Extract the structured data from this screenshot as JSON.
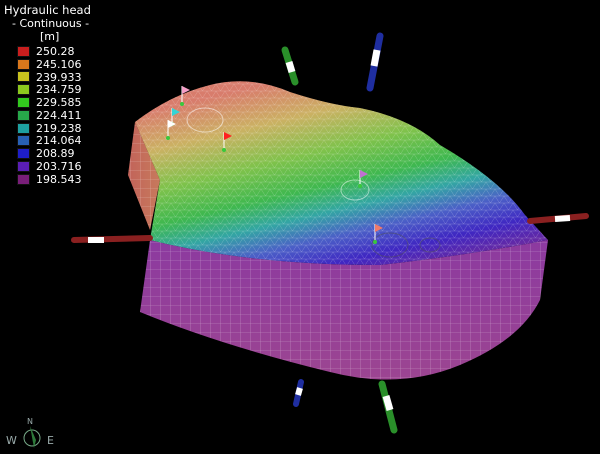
{
  "legend": {
    "title": "Hydraulic head",
    "subtitle": "- Continuous -",
    "unit": "[m]",
    "entries": [
      {
        "value": "250.28",
        "color": "#c81e1e"
      },
      {
        "value": "245.106",
        "color": "#d9771c"
      },
      {
        "value": "239.933",
        "color": "#c8c21e"
      },
      {
        "value": "234.759",
        "color": "#8cc81e"
      },
      {
        "value": "229.585",
        "color": "#32c81e"
      },
      {
        "value": "224.411",
        "color": "#27a84a"
      },
      {
        "value": "219.238",
        "color": "#1ea0a0"
      },
      {
        "value": "214.064",
        "color": "#2860b4"
      },
      {
        "value": "208.89",
        "color": "#1e1ec8"
      },
      {
        "value": "203.716",
        "color": "#5a1eb4"
      },
      {
        "value": "198.543",
        "color": "#781e78"
      }
    ]
  },
  "compass": {
    "west": "W",
    "east": "E",
    "north": "N"
  },
  "scene": {
    "surface_colors": {
      "high": "#d47a6e",
      "mid": "#39b54a",
      "low": "#3a2bd0",
      "wall": "#9a3f90"
    },
    "well_icons": [
      "well-marker-icon",
      "flag-icon"
    ]
  }
}
